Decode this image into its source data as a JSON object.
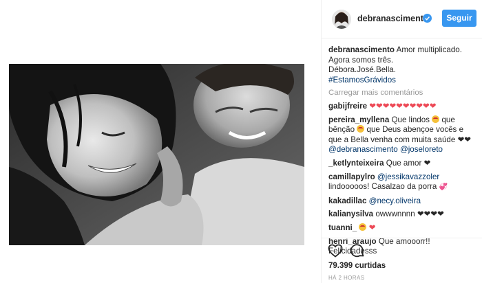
{
  "header": {
    "username": "debranascimento",
    "follow_label": "Seguir"
  },
  "caption": {
    "username": "debranascimento",
    "line1": "Amor multiplicado.",
    "line2": "Agora somos três.",
    "line3": "Débora.José.Bella.",
    "hashtag": "#EstamosGrávidos"
  },
  "load_more": "Carregar mais comentários",
  "comments": [
    {
      "username": "gabijfreire",
      "hearts": "❤❤❤❤❤❤❤❤❤❤"
    },
    {
      "username": "pereira_myllena",
      "text_a": "Que lindos",
      "text_b": "que bênção",
      "text_c": "que Deus abençoe vocês e que a Bella venha com muita saúde",
      "hearts": "❤❤",
      "mention_a": "@debranascimento",
      "mention_b": "@joseloreto"
    },
    {
      "username": "_ketlynteixeira",
      "text": "Que amor",
      "hearts": "❤"
    },
    {
      "username": "camillapylro",
      "mention": "@jessikavazzoler",
      "text_a": "lindooooos!",
      "text_b": "Casalzao da porra",
      "hearts": "💞"
    },
    {
      "username": "kakadillac",
      "mention": "@necy.oliveira"
    },
    {
      "username": "kalianysilva",
      "text": "owwwnnnn",
      "hearts": "❤❤❤❤"
    },
    {
      "username": "tuanni_",
      "hearts": "❤"
    },
    {
      "username": "henri_araujo",
      "text": "Que amooorr!! Felicidadesss"
    }
  ],
  "likes": "79.399 curtidas",
  "time": "HÁ 2 HORAS",
  "icons": {
    "like": "heart-outline-icon",
    "comment": "speech-bubble-icon",
    "verified": "verified-badge-icon"
  },
  "colors": {
    "accent": "#3897f0",
    "link": "#003569",
    "heart": "#ed4956",
    "muted": "#999999"
  }
}
